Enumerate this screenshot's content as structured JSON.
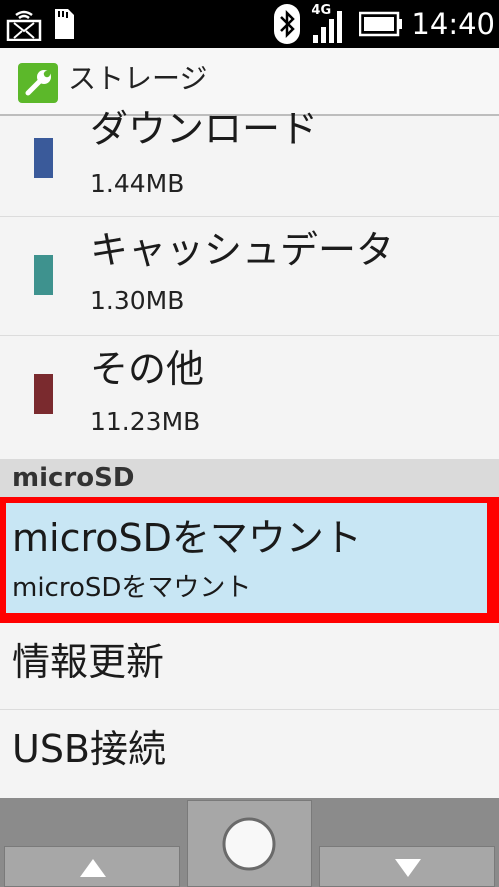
{
  "status_bar": {
    "network_label": "4G",
    "time": "14:40",
    "icons": [
      "wifi-hotspot-icon",
      "sd-card-icon",
      "bluetooth-icon",
      "signal-icon",
      "battery-icon"
    ]
  },
  "header": {
    "title": "ストレージ",
    "icon": "wrench-icon",
    "icon_color": "#5cb82a"
  },
  "storage_items": [
    {
      "name": "ダウンロード",
      "size": "1.44MB",
      "color": "#3a5a9a"
    },
    {
      "name": "キャッシュデータ",
      "size": "1.30MB",
      "color": "#3e928e"
    },
    {
      "name": "その他",
      "size": "11.23MB",
      "color": "#7a2a2e"
    }
  ],
  "section": {
    "label": "microSD"
  },
  "mount": {
    "title": "microSDをマウント",
    "subtitle": "microSDをマウント",
    "highlight_color": "#ff0000",
    "background_color": "#c8e6f4"
  },
  "actions": [
    {
      "label": "情報更新"
    },
    {
      "label": "USB接続"
    }
  ],
  "nav": {
    "up": "triangle-up-icon",
    "center": "circle-icon",
    "down": "triangle-down-icon"
  }
}
